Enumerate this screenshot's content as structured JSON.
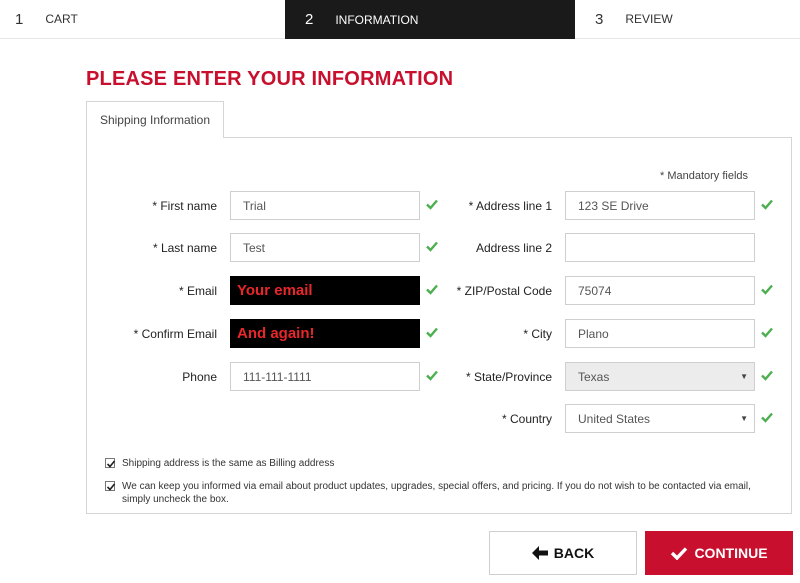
{
  "steps": [
    {
      "num": "1",
      "label": "CART"
    },
    {
      "num": "2",
      "label": "INFORMATION"
    },
    {
      "num": "3",
      "label": "REVIEW"
    }
  ],
  "page_title": "PLEASE ENTER YOUR INFORMATION",
  "tab_label": "Shipping Information",
  "mandatory_note": "* Mandatory fields",
  "fields": {
    "first_name": {
      "label": "* First name",
      "value": "Trial"
    },
    "last_name": {
      "label": "* Last name",
      "value": "Test"
    },
    "email": {
      "label": "* Email",
      "value": "Your email"
    },
    "confirm_email": {
      "label": "* Confirm Email",
      "value": "And again!"
    },
    "phone": {
      "label": "Phone",
      "value": "111-111-1111"
    },
    "address1": {
      "label": "* Address line 1",
      "value": "123 SE Drive"
    },
    "address2": {
      "label": "Address line 2",
      "value": ""
    },
    "zip": {
      "label": "* ZIP/Postal Code",
      "value": "75074"
    },
    "city": {
      "label": "* City",
      "value": "Plano"
    },
    "state": {
      "label": "* State/Province",
      "value": "Texas"
    },
    "country": {
      "label": "* Country",
      "value": "United States"
    }
  },
  "checkboxes": {
    "same_billing": "Shipping address is the same as Billing address",
    "email_optin_line1": "We can keep you informed via email about product updates, upgrades, special offers, and pricing. If you do not wish to be contacted via email,",
    "email_optin_line2": "simply uncheck the box."
  },
  "buttons": {
    "back": "BACK",
    "continue": "CONTINUE"
  },
  "colors": {
    "accent": "#c8102e",
    "check": "#4caf50",
    "step_active_bg": "#1a1a1a"
  }
}
